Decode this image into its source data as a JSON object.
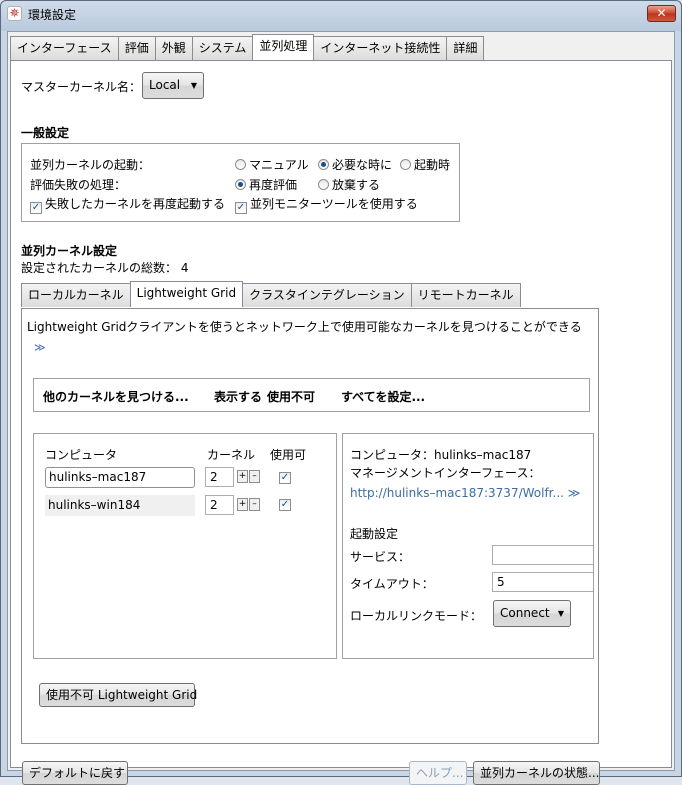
{
  "window": {
    "title": "環境設定",
    "close_label": "✕",
    "app_icon": "mathematica-star-icon"
  },
  "main_tabs": [
    "インターフェース",
    "評価",
    "外観",
    "システム",
    "並列処理",
    "インターネット接続性",
    "詳細"
  ],
  "master_kernel": {
    "label": "マスターカーネル名：",
    "value": "Local"
  },
  "general": {
    "heading": "一般設定",
    "startup_label": "並列カーネルの起動：",
    "startup_options": [
      "マニュアル",
      "必要な時に",
      "起動時"
    ],
    "startup_selected": "必要な時に",
    "failure_label": "評価失敗の処理：",
    "failure_options": [
      "再度評価",
      "放棄する"
    ],
    "failure_selected": "再度評価",
    "restart_check": "失敗したカーネルを再度起動する",
    "monitor_check": "並列モニターツールを使用する",
    "check_mark": "✓"
  },
  "kernel_settings": {
    "heading": "並列カーネル設定",
    "count_text": "設定されたカーネルの総数： 4",
    "tabs": [
      "ローカルカーネル",
      "Lightweight Grid",
      "クラスタインテグレーション",
      "リモートカーネル"
    ]
  },
  "grid": {
    "description": "Lightweight Gridクライアントを使うとネットワーク上で使用可能なカーネルを見つけることができる",
    "more_glyph": "≫",
    "toolbar": [
      "他のカーネルを見つける...",
      "表示する",
      "使用不可",
      "すべてを設定..."
    ],
    "columns": {
      "computer": "コンピュータ",
      "kernels": "カーネル",
      "enabled": "使用可"
    },
    "rows": [
      {
        "name": "hulinks–mac187",
        "kernels": "2",
        "enabled": true
      },
      {
        "name": "hulinks–win184",
        "kernels": "2",
        "enabled": true
      }
    ],
    "plus": "+",
    "minus": "–",
    "detail": {
      "computer_line": "コンピュータ：hulinks–mac187",
      "mgmt_label": "マネージメントインターフェース：",
      "mgmt_url": "http://hulinks–mac187:3737/Wolfr...",
      "mgmt_more": "≫",
      "startup_heading": "起動設定",
      "service_label": "サービス：",
      "service_value": "",
      "timeout_label": "タイムアウト：",
      "timeout_value": "5",
      "linkmode_label": "ローカルリンクモード：",
      "linkmode_value": "Connect"
    },
    "disable_button": "使用不可 Lightweight Grid"
  },
  "footer": {
    "reset": "デフォルトに戻す",
    "help": "ヘルプ...",
    "status": "並列カーネルの状態..."
  }
}
